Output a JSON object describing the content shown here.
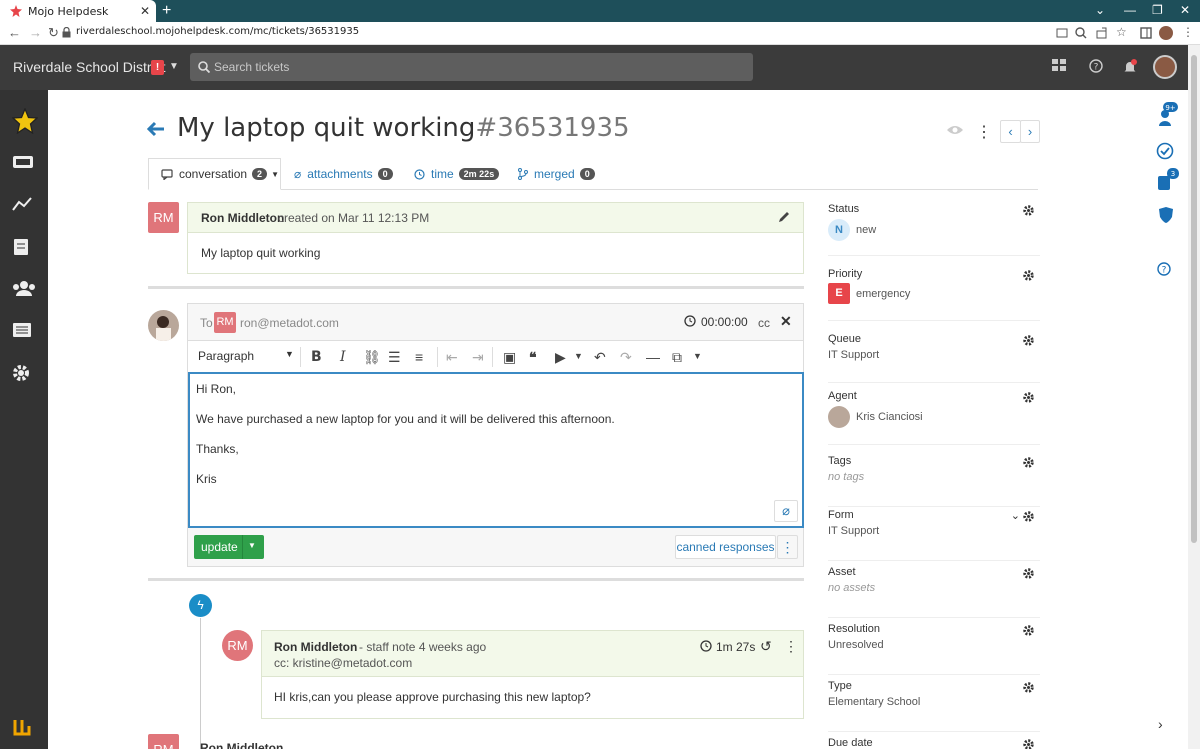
{
  "browser": {
    "tab_title": "Mojo Helpdesk",
    "url": "riverdaleschool.mojohelpdesk.com/mc/tickets/36531935"
  },
  "header": {
    "org_name": "Riverdale School District",
    "org_badge": "!",
    "search_placeholder": "Search tickets"
  },
  "ticket": {
    "title": "My laptop quit working",
    "number": "#36531935",
    "tabs": [
      {
        "label": "conversation",
        "count": "2"
      },
      {
        "label": "attachments",
        "count": "0"
      },
      {
        "label": "time",
        "count": "2m 22s"
      },
      {
        "label": "merged",
        "count": "0"
      }
    ]
  },
  "original": {
    "initials": "RM",
    "author": "Ron Middleton",
    "meta": "created on Mar 11 12:13 PM",
    "body": "My laptop quit working"
  },
  "reply": {
    "to_label": "To",
    "recipient_initials": "RM",
    "recipient_email": "ron@metadot.com",
    "timer": "00:00:00",
    "cc": "cc",
    "block_format": "Paragraph",
    "body_lines": [
      "Hi Ron,",
      "We have purchased a new laptop for you and it will be delivered this afternoon.",
      "Thanks,",
      "Kris"
    ],
    "update_label": "update",
    "canned_label": "canned responses"
  },
  "note": {
    "initials": "RM",
    "author": "Ron Middleton",
    "meta": "- staff note 4 weeks ago",
    "cc": "cc: kristine@metadot.com",
    "duration": "1m 27s",
    "body": "HI kris,can you please approve purchasing this new laptop?"
  },
  "next_entry": {
    "initials": "RM",
    "author": "Ron Middleton"
  },
  "props": {
    "status": {
      "label": "Status",
      "badge": "N",
      "value": "new"
    },
    "priority": {
      "label": "Priority",
      "badge": "E",
      "value": "emergency"
    },
    "queue": {
      "label": "Queue",
      "value": "IT Support"
    },
    "agent": {
      "label": "Agent",
      "value": "Kris Cianciosi"
    },
    "tags": {
      "label": "Tags",
      "value": "no tags"
    },
    "form": {
      "label": "Form",
      "value": "IT Support"
    },
    "asset": {
      "label": "Asset",
      "value": "no assets"
    },
    "resolution": {
      "label": "Resolution",
      "value": "Unresolved"
    },
    "type": {
      "label": "Type",
      "value": "Elementary School"
    },
    "due": {
      "label": "Due date"
    }
  },
  "rail": {
    "badge_top": "9+",
    "badge_mid": "3"
  },
  "colors": {
    "accent": "#2a7ab5",
    "green": "#2fa04a",
    "danger": "#e7454a",
    "header": "#3b3b3b",
    "sidebar": "#333333"
  }
}
